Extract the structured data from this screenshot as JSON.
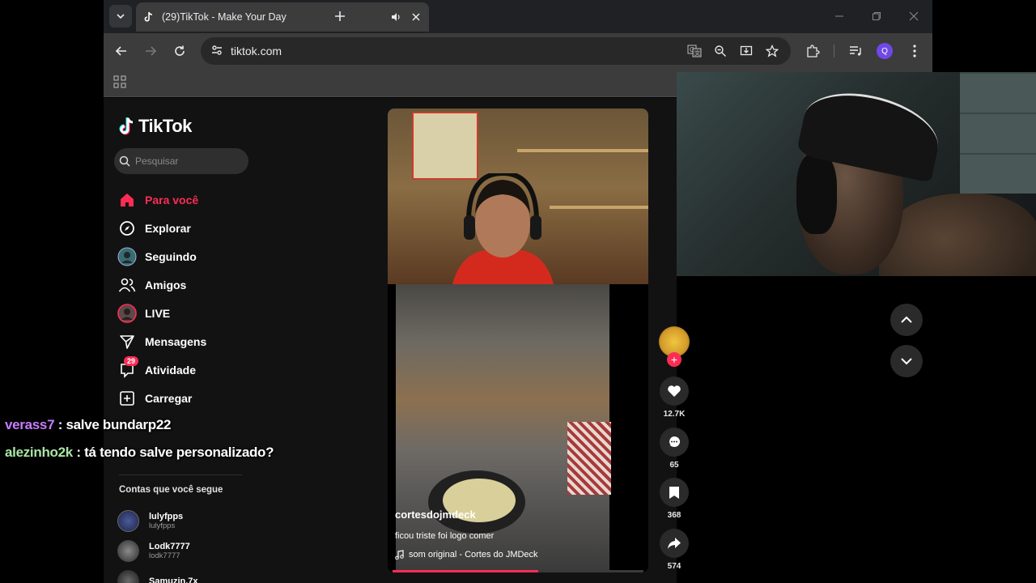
{
  "browser": {
    "tab_title": "(29)TikTok - Make Your Day",
    "url": "tiktok.com",
    "profile_initial": "Q"
  },
  "tiktok": {
    "logo_text": "TikTok",
    "search_placeholder": "Pesquisar",
    "nav": [
      {
        "label": "Para você",
        "icon": "home-icon",
        "active": true
      },
      {
        "label": "Explorar",
        "icon": "compass-icon"
      },
      {
        "label": "Seguindo",
        "icon": "following-avatar-icon"
      },
      {
        "label": "Amigos",
        "icon": "friends-icon"
      },
      {
        "label": "LIVE",
        "icon": "live-avatar-icon"
      },
      {
        "label": "Mensagens",
        "icon": "send-icon"
      },
      {
        "label": "Atividade",
        "icon": "activity-icon",
        "badge": "29"
      },
      {
        "label": "Carregar",
        "icon": "upload-icon"
      }
    ],
    "following_title": "Contas que você segue",
    "following": [
      {
        "name": "lulyfpps",
        "handle": "lulyfpps"
      },
      {
        "name": "Lodk7777",
        "handle": "lodk7777"
      },
      {
        "name": "Samuzin.7x",
        "handle": ""
      }
    ]
  },
  "video": {
    "username": "cortesdojmdeck",
    "description": "ficou triste foi logo comer",
    "music": "som original - Cortes do JMDeck",
    "progress_fraction": 0.58,
    "likes": "12.7K",
    "comments": "65",
    "saves": "368",
    "shares": "574"
  },
  "chat": [
    {
      "user": "verass7",
      "message": ": salve bundarp22",
      "color": "#c77dff"
    },
    {
      "user": "alezinho2k",
      "message": ": tá tendo salve personalizado?",
      "color": "#a8e6a3"
    }
  ],
  "colors": {
    "accent": "#fe2c55"
  }
}
